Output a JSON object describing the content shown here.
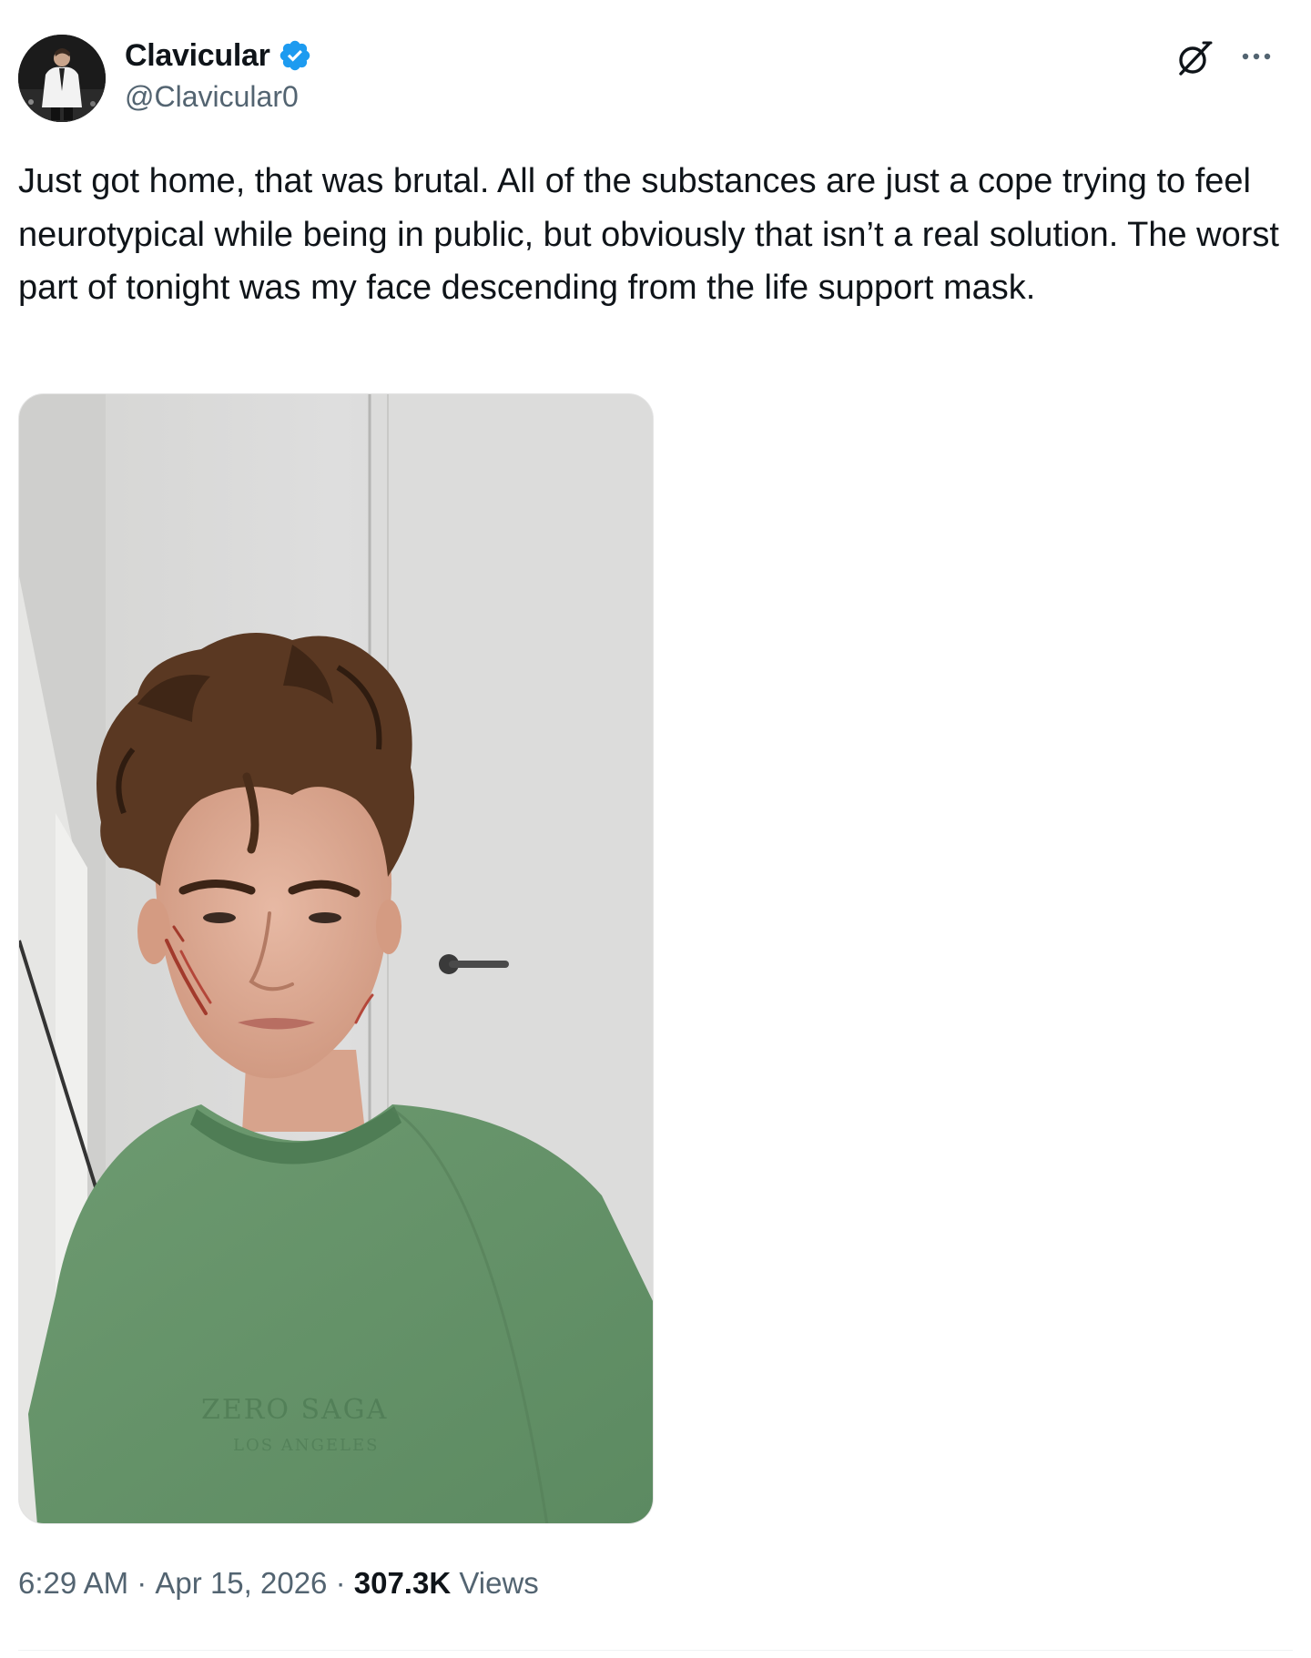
{
  "author": {
    "display_name": "Clavicular",
    "handle": "@Clavicular0",
    "verified": true
  },
  "post": {
    "text": "Just got home, that was brutal. All of the substances are just a cope trying to feel neurotypical while being in public, but obviously that isn’t a real solution. The worst part of tonight was my face descending from the life support mask.",
    "media": {
      "type": "photo",
      "subject": "selfie of man with curly brown hair in green t-shirt with scratches on cheek, white door behind"
    },
    "time": "6:29 AM",
    "separator": "·",
    "date": "Apr 15, 2026",
    "views_count": "307.3K",
    "views_label": "Views"
  },
  "icons": {
    "verified": "verified-badge-icon",
    "grok": "grok-icon",
    "more": "more-options-icon"
  },
  "colors": {
    "verified_blue": "#1d9bf0",
    "text_primary": "#0f1419",
    "text_secondary": "#536471"
  }
}
